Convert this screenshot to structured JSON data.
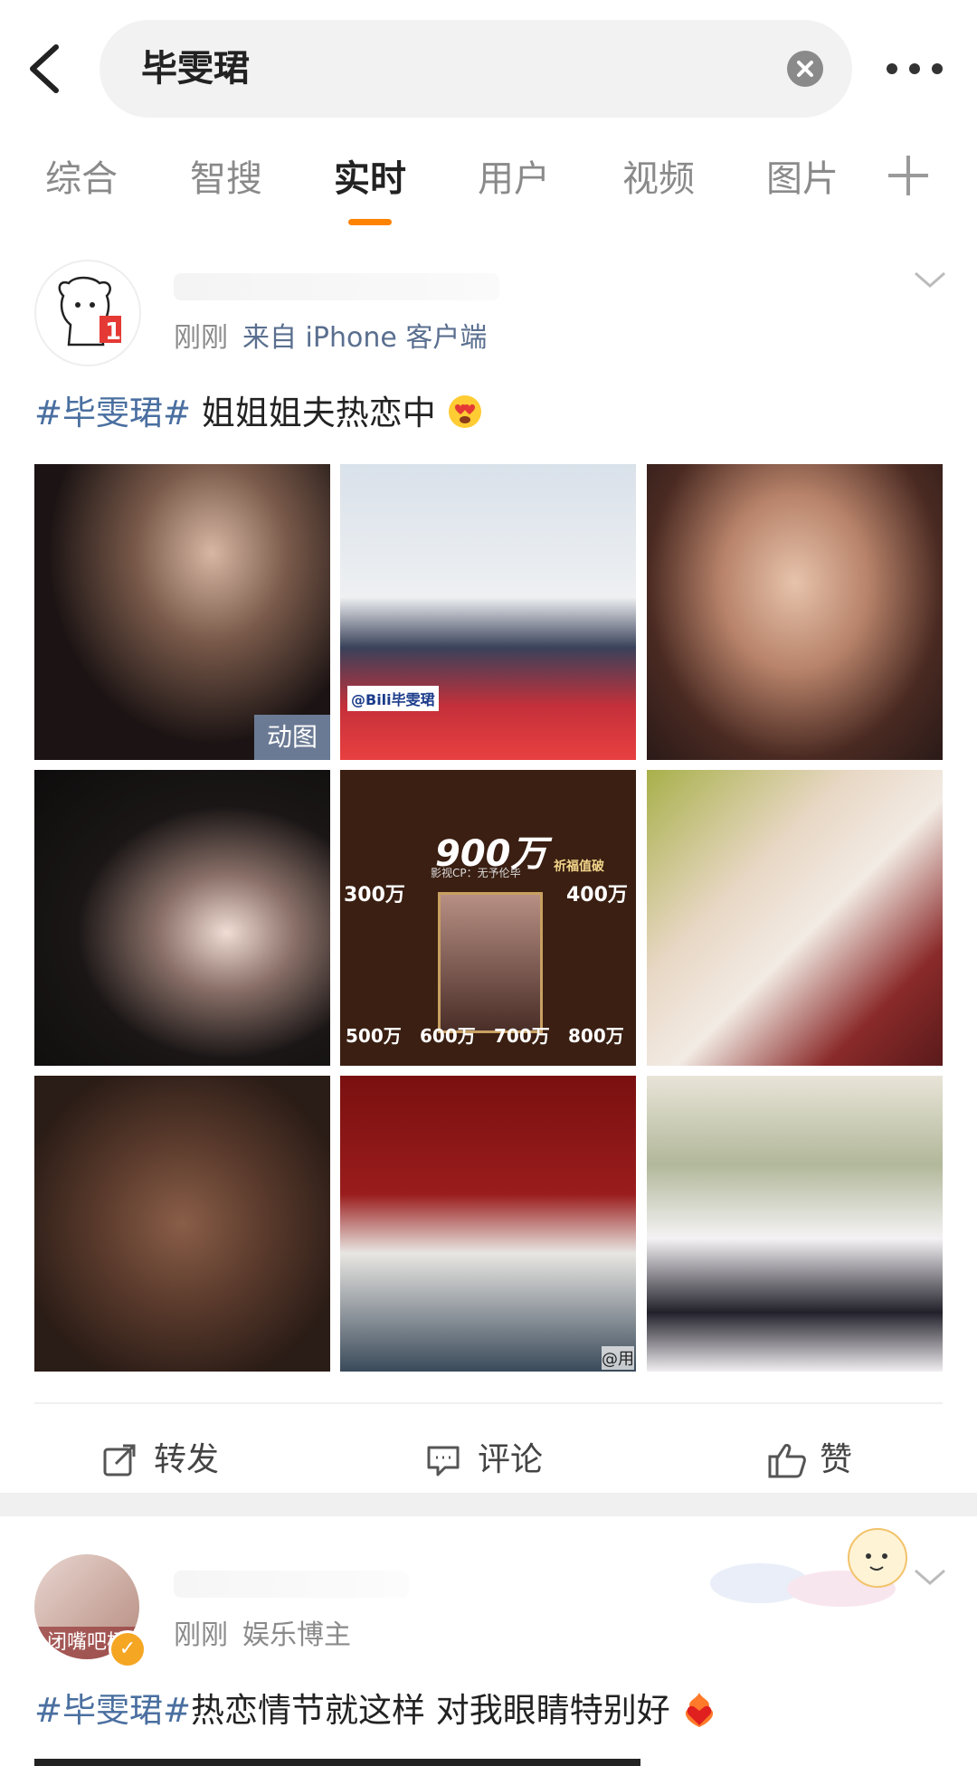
{
  "header": {
    "back_icon": "chevron-left-icon",
    "search_query": "毕雯珺",
    "clear_icon": "close-circle-icon",
    "more_icon": "more-dots-icon"
  },
  "tabs": [
    {
      "label": "综合",
      "active": false
    },
    {
      "label": "智搜",
      "active": false
    },
    {
      "label": "实时",
      "active": true
    },
    {
      "label": "用户",
      "active": false
    },
    {
      "label": "视频",
      "active": false
    },
    {
      "label": "图片",
      "active": false
    }
  ],
  "tab_add_icon": "plus-icon",
  "accent_color": "#ff8200",
  "post1": {
    "time": "刚刚",
    "source": "来自 iPhone 客户端",
    "hashtag": "#毕雯珺#",
    "text": " 姐姐姐夫热恋中",
    "emoji": "heart-eyes-emoji",
    "images": [
      {
        "desc": "photo-1",
        "badge": "动图"
      },
      {
        "desc": "photo-2",
        "caption": "@Bili毕雯珺"
      },
      {
        "desc": "photo-3"
      },
      {
        "desc": "photo-4"
      },
      {
        "desc": "photo-5",
        "labels": [
          "900万",
          "300万",
          "400万",
          "500万",
          "600万",
          "700万",
          "800万",
          "祈福值破",
          "影视CP：无予伦毕"
        ]
      },
      {
        "desc": "photo-6"
      },
      {
        "desc": "photo-7"
      },
      {
        "desc": "photo-8",
        "caption": "@用"
      },
      {
        "desc": "photo-9"
      }
    ],
    "actions": {
      "repost": "转发",
      "comment": "评论",
      "like": "赞"
    }
  },
  "post2": {
    "avatar_caption": "闭嘴吧杨",
    "time": "刚刚",
    "tag": "娱乐博主",
    "hashtag": "#毕雯珺#",
    "text": "热恋情节就这样 对我眼睛特别好",
    "emoji": "heart-on-fire-emoji"
  }
}
